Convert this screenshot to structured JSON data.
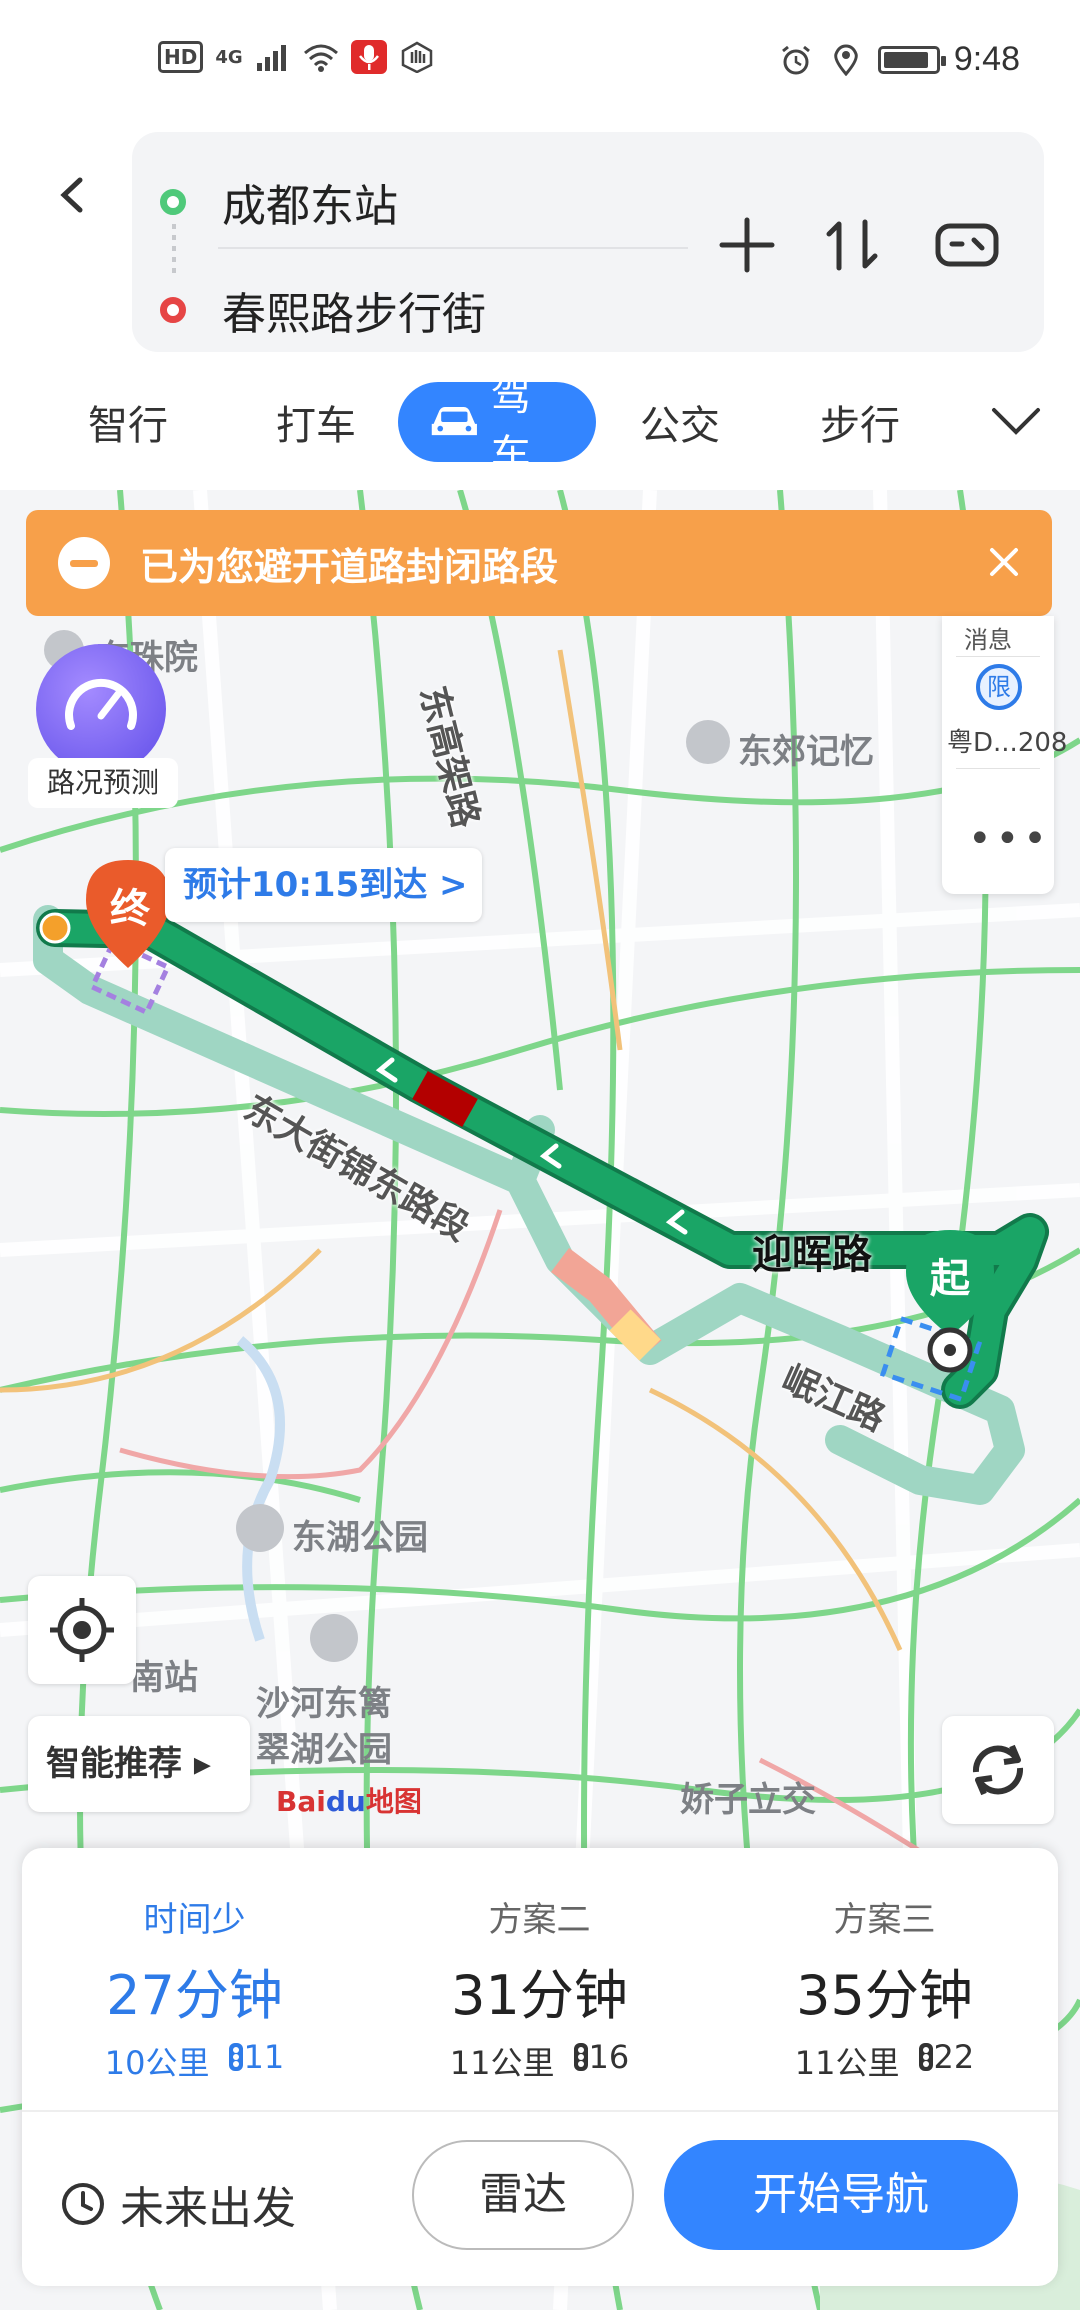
{
  "status_bar": {
    "hd": "HD",
    "network": "4G",
    "time": "9:48"
  },
  "header": {
    "origin": "成都东站",
    "destination": "春熙路步行街",
    "tabs": [
      {
        "label": "智行"
      },
      {
        "label": "打车"
      },
      {
        "label": "驾车",
        "active": true
      },
      {
        "label": "公交"
      },
      {
        "label": "步行"
      }
    ]
  },
  "map": {
    "notice": "已为您避开道路封闭路段",
    "traffic_forecast": "路况预测",
    "right_panel": {
      "top_label": "消息",
      "limit_badge": "限",
      "plate": "粤D...208"
    },
    "eta": "预计10:15到达 >",
    "end_marker": "终",
    "start_marker": "起",
    "smart_recommend": "智能推荐 ▸",
    "logo_bai": "Bai",
    "logo_du": "du",
    "logo_map": "地图",
    "labels": {
      "poi1": "东珠院",
      "poi2": "东郊记忆",
      "poi3": "东湖公园",
      "poi4": "沙河东篱",
      "poi5": "翠湖公园",
      "poi6": "娇子立交",
      "poi7": "南站",
      "road1": "东高架路",
      "road2": "东大街锦东路段",
      "road3": "迎晖路",
      "road4": "岷江路"
    }
  },
  "plans": [
    {
      "name": "时间少",
      "time": "27分钟",
      "distance": "10公里",
      "lights": "11",
      "selected": true
    },
    {
      "name": "方案二",
      "time": "31分钟",
      "distance": "11公里",
      "lights": "16"
    },
    {
      "name": "方案三",
      "time": "35分钟",
      "distance": "11公里",
      "lights": "22"
    }
  ],
  "actions": {
    "future": "未来出发",
    "radar": "雷达",
    "navigate": "开始导航"
  },
  "colors": {
    "accent": "#3385ff",
    "route_green": "#1aa566",
    "alt_route": "#9fd6c3",
    "congestion": "#b30000",
    "notice": "#f7a04a"
  }
}
